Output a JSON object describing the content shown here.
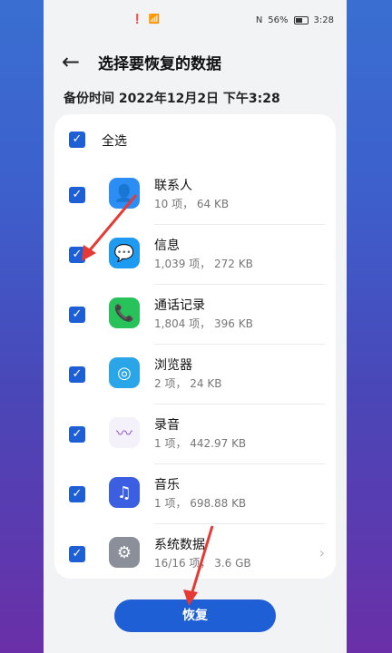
{
  "status": {
    "left_icons": [
      "!",
      "wifi"
    ],
    "nfc": "N",
    "battery": "56%",
    "time": "3:28"
  },
  "header": {
    "back_icon": "←",
    "title": "选择要恢复的数据"
  },
  "backup_time": "备份时间 2022年12月2日 下午3:28",
  "select_all": {
    "label": "全选",
    "checked": true
  },
  "items": [
    {
      "name": "联系人",
      "meta": "10 项， 64 KB",
      "icon": "contacts-icon",
      "color": "#2c8ef5",
      "glyph": "👤",
      "checked": true
    },
    {
      "name": "信息",
      "meta": "1,039 项， 272 KB",
      "icon": "messages-icon",
      "color": "#1e9bf0",
      "glyph": "💬",
      "checked": true
    },
    {
      "name": "通话记录",
      "meta": "1,804 项， 396 KB",
      "icon": "phone-icon",
      "color": "#27c25a",
      "glyph": "📞",
      "checked": true
    },
    {
      "name": "浏览器",
      "meta": "2 项， 24 KB",
      "icon": "browser-icon",
      "color": "#2aa6e8",
      "glyph": "◎",
      "checked": true
    },
    {
      "name": "录音",
      "meta": "1 项， 442.97 KB",
      "icon": "recorder-icon",
      "color": "#f4f1fb",
      "glyph": "〰",
      "checked": true
    },
    {
      "name": "音乐",
      "meta": "1 项， 698.88 KB",
      "icon": "music-icon",
      "color": "#3b5fe0",
      "glyph": "♫",
      "checked": true
    },
    {
      "name": "系统数据",
      "meta": "16/16 项， 3.6 GB",
      "icon": "system-data-icon",
      "color": "#8a8f99",
      "glyph": "⚙",
      "checked": true,
      "chevron": "›"
    }
  ],
  "restore_button": "恢复",
  "colors": {
    "accent": "#1f5fd6",
    "arrow": "#e53935"
  }
}
